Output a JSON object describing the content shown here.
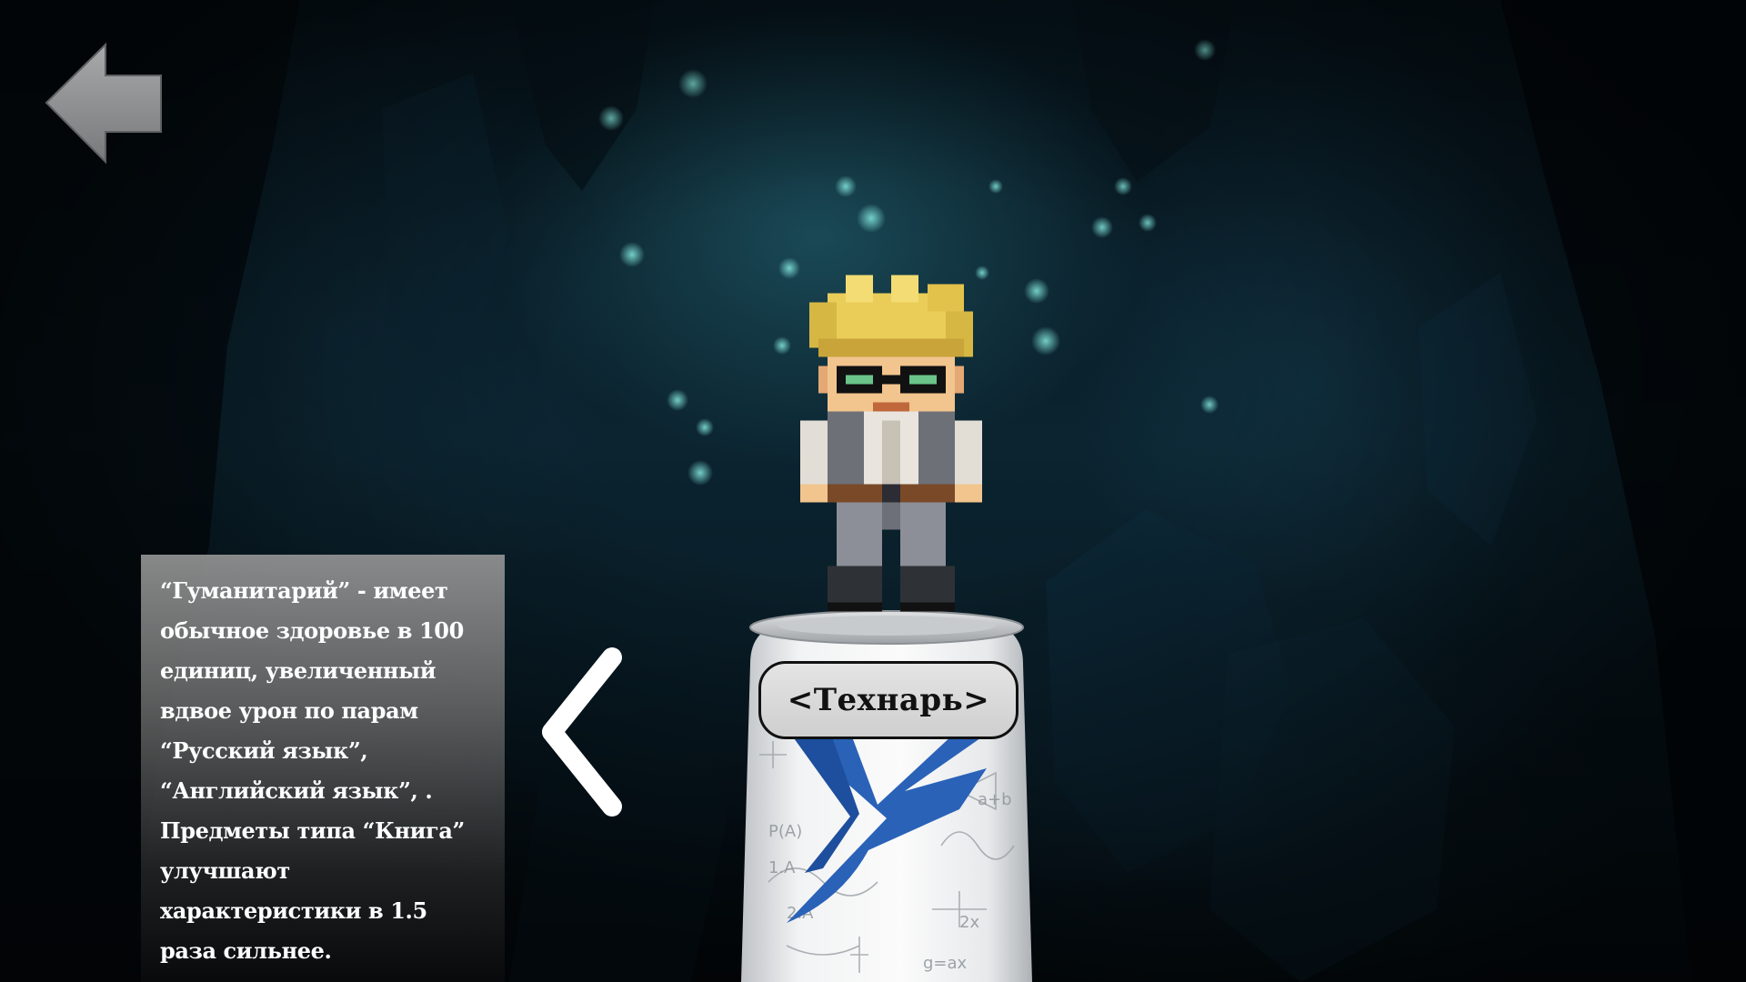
{
  "screen": "class-selection",
  "back_button": {
    "icon": "arrow-left-icon",
    "color": "#8a8c8e"
  },
  "description": {
    "text": "“Гуманитарий” - имеет обычное здоровье в 100 единиц, увеличенный вдвое урон по парам “Русский язык”, “Английский язык”, . Предметы типа “Книга” улучшают характеристики в 1.5 раза сильнее."
  },
  "navigation": {
    "prev_icon": "chevron-left-icon"
  },
  "selected_class": {
    "label": "<Технарь>",
    "pedestal": "energy-drink-can",
    "pedestal_logo_colors": [
      "#2a62b8",
      "#1e4f9e"
    ]
  },
  "colors": {
    "accent": "#2a62b8",
    "panel_text": "#ffffff",
    "button_fill": "#d8d8d8",
    "button_border": "#111111"
  }
}
